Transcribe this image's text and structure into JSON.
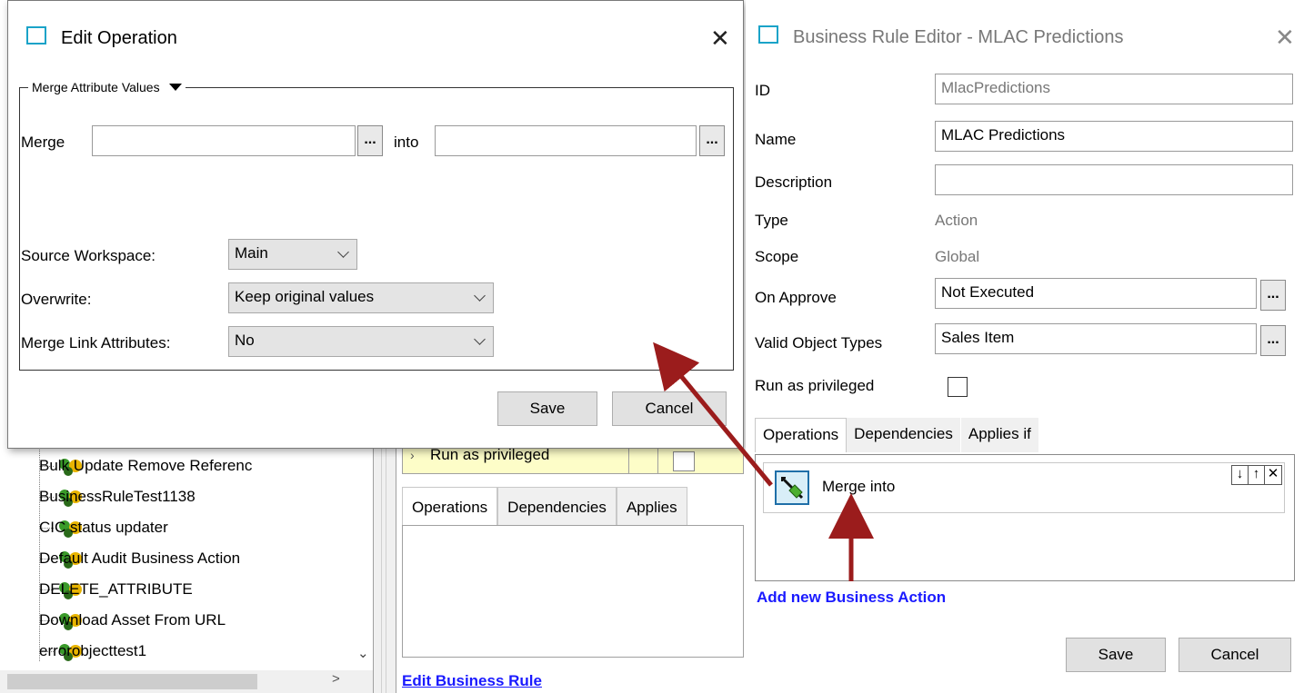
{
  "background": {
    "tree_items": [
      "Bulk Update Remove Referenc",
      "BusinessRuleTest1138",
      "CIC status updater",
      "Default Audit Business Action",
      "DELETE_ATTRIBUTE",
      "Download Asset From URL",
      "errorobjecttest1"
    ],
    "priv_row_label": "Run as privileged",
    "tabs": [
      "Operations",
      "Dependencies",
      "Applies"
    ],
    "edit_link": "Edit Business Rule",
    "scroll_down_glyph": "⌄",
    "scroll_right_glyph": ">"
  },
  "edit_dialog": {
    "title": "Edit Operation",
    "close_glyph": "✕",
    "group_legend": "Merge Attribute Values",
    "merge_label": "Merge",
    "into_label": "into",
    "browse_label": "...",
    "source_workspace_label": "Source Workspace:",
    "source_workspace_value": "Main",
    "overwrite_label": "Overwrite:",
    "overwrite_value": "Keep original values",
    "merge_link_label": "Merge Link Attributes:",
    "merge_link_value": "No",
    "save": "Save",
    "cancel": "Cancel"
  },
  "bre_dialog": {
    "title": "Business Rule Editor - MLAC Predictions",
    "close_glyph": "✕",
    "id_label": "ID",
    "id_value": "MlacPredictions",
    "name_label": "Name",
    "name_value": "MLAC Predictions",
    "description_label": "Description",
    "description_value": "",
    "type_label": "Type",
    "type_value": "Action",
    "scope_label": "Scope",
    "scope_value": "Global",
    "on_approve_label": "On Approve",
    "on_approve_value": "Not Executed",
    "valid_types_label": "Valid Object Types",
    "valid_types_value": "Sales Item",
    "run_priv_label": "Run as privileged",
    "browse_label": "...",
    "tabs": [
      "Operations",
      "Dependencies",
      "Applies if"
    ],
    "operation_label": "Merge  into",
    "op_controls": [
      "↓",
      "↑",
      "✕"
    ],
    "add_action_link": "Add new Business Action",
    "save": "Save",
    "cancel": "Cancel"
  },
  "colors": {
    "arrow": "#9b1c1c",
    "link": "#1a1aff",
    "title_icon": "#1aa3c8"
  }
}
